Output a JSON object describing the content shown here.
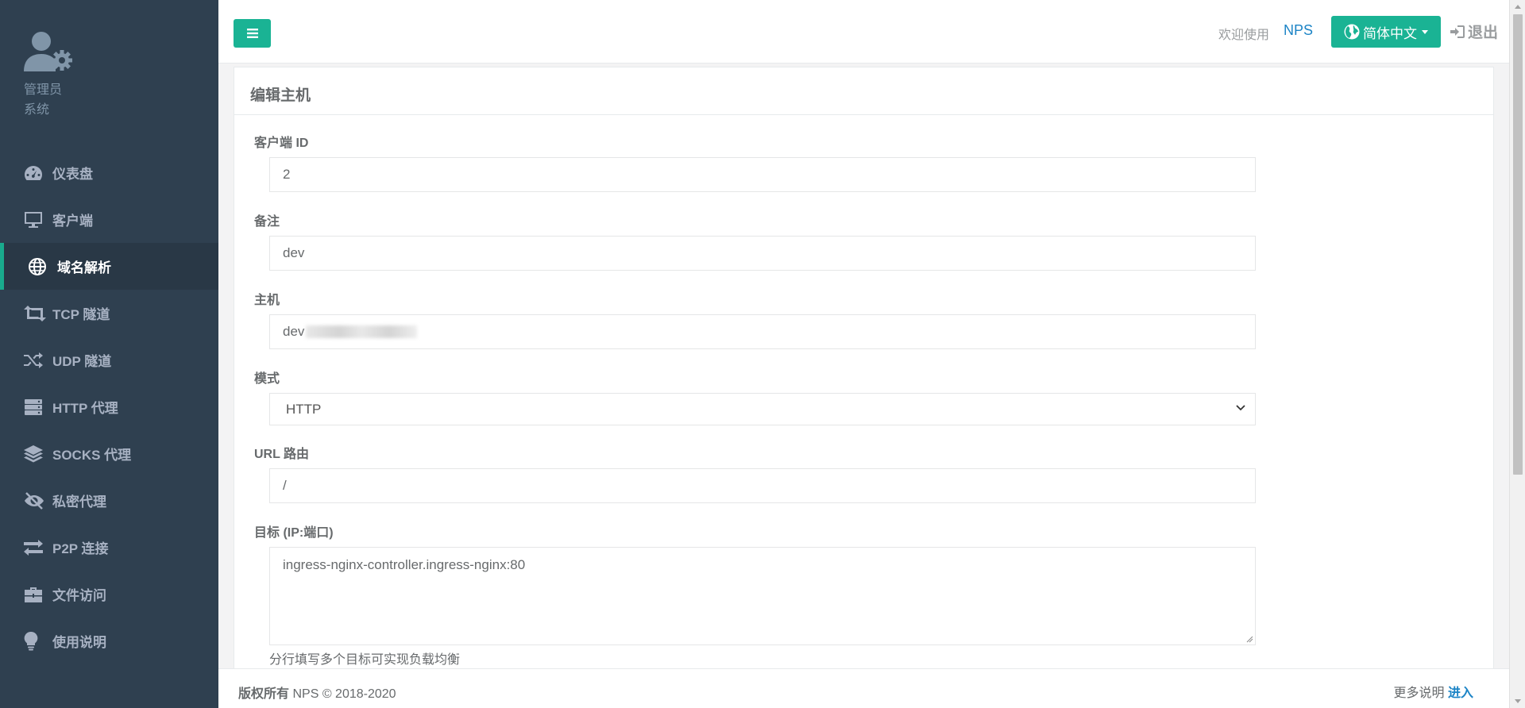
{
  "sidebar": {
    "profile_name": "管理员",
    "profile_role": "系统",
    "items": [
      {
        "label": "仪表盘",
        "icon": "dashboard-icon"
      },
      {
        "label": "客户端",
        "icon": "desktop-icon"
      },
      {
        "label": "域名解析",
        "icon": "globe-icon",
        "active": true
      },
      {
        "label": "TCP 隧道",
        "icon": "retweet-icon"
      },
      {
        "label": "UDP 隧道",
        "icon": "random-icon"
      },
      {
        "label": "HTTP 代理",
        "icon": "server-icon"
      },
      {
        "label": "SOCKS 代理",
        "icon": "layers-icon"
      },
      {
        "label": "私密代理",
        "icon": "eye-slash-icon"
      },
      {
        "label": "P2P 连接",
        "icon": "exchange-icon"
      },
      {
        "label": "文件访问",
        "icon": "briefcase-icon"
      },
      {
        "label": "使用说明",
        "icon": "lightbulb-icon"
      }
    ]
  },
  "header": {
    "welcome": "欢迎使用",
    "brand": "NPS",
    "language": "简体中文",
    "logout": "退出"
  },
  "form": {
    "title": "编辑主机",
    "client_id": {
      "label": "客户端 ID",
      "value": "2"
    },
    "remark": {
      "label": "备注",
      "value": "dev"
    },
    "host": {
      "label": "主机",
      "value": "dev"
    },
    "mode": {
      "label": "模式",
      "value": "HTTP"
    },
    "url_route": {
      "label": "URL 路由",
      "value": "/"
    },
    "target": {
      "label": "目标 (IP:端口)",
      "value": "ingress-nginx-controller.ingress-nginx:80",
      "help": "分行填写多个目标可实现负载均衡"
    }
  },
  "footer": {
    "copyright_label": "版权所有",
    "copyright_text": "NPS © 2018-2020",
    "more_label": "更多说明",
    "more_link": "进入"
  },
  "colors": {
    "sidebar_bg": "#2f4050",
    "accent": "#1ab394",
    "link": "#1c84c6"
  }
}
